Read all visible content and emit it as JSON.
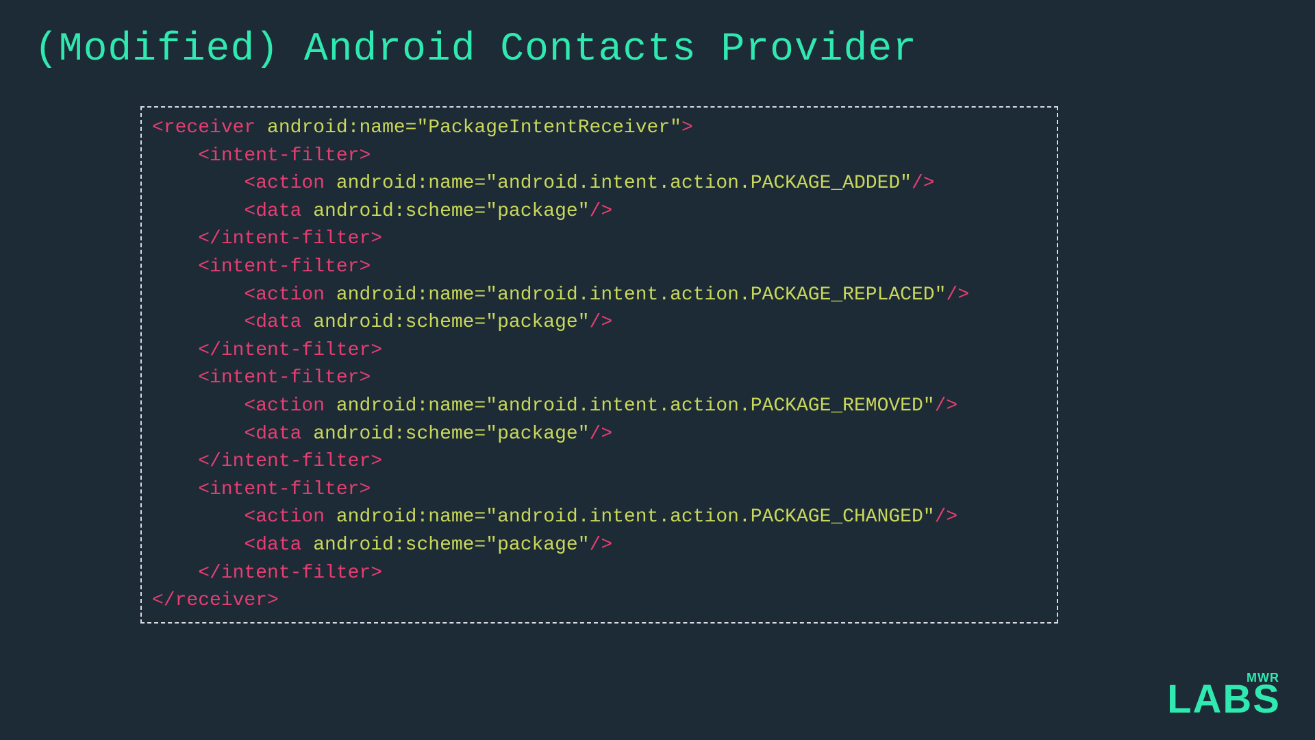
{
  "title": "(Modified) Android Contacts Provider",
  "code": {
    "receiver_open_tag": "<receiver",
    "receiver_attr": " android:name=\"PackageIntentReceiver\"",
    "receiver_open_close": ">",
    "intent_filter_open": "    <intent-filter>",
    "intent_filter_close": "    </intent-filter>",
    "receiver_close": "</receiver>",
    "filters": [
      {
        "action_tag": "        <action",
        "action_attr": " android:name=\"android.intent.action.PACKAGE_ADDED\"",
        "action_close": "/>",
        "data_tag": "        <data",
        "data_attr": " android:scheme=\"package\"",
        "data_close": "/>"
      },
      {
        "action_tag": "        <action",
        "action_attr": " android:name=\"android.intent.action.PACKAGE_REPLACED\"",
        "action_close": "/>",
        "data_tag": "        <data",
        "data_attr": " android:scheme=\"package\"",
        "data_close": "/>"
      },
      {
        "action_tag": "        <action",
        "action_attr": " android:name=\"android.intent.action.PACKAGE_REMOVED\"",
        "action_close": "/>",
        "data_tag": "        <data",
        "data_attr": " android:scheme=\"package\"",
        "data_close": "/>"
      },
      {
        "action_tag": "        <action",
        "action_attr": " android:name=\"android.intent.action.PACKAGE_CHANGED\"",
        "action_close": "/>",
        "data_tag": "        <data",
        "data_attr": " android:scheme=\"package\"",
        "data_close": "/>"
      }
    ]
  },
  "logo": {
    "top": "MWR",
    "bottom": "LABS"
  }
}
